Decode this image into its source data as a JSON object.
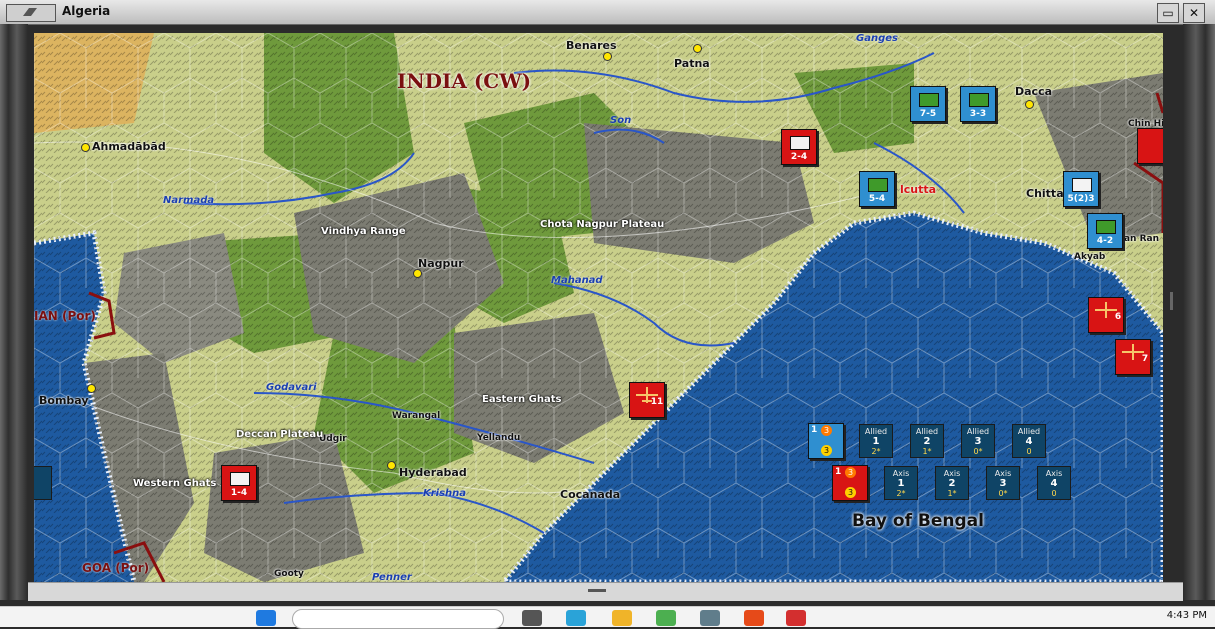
{
  "window": {
    "title": "Algeria",
    "buttons": [
      "▭",
      "✕"
    ]
  },
  "labels": {
    "country_india": "INDIA (CW)",
    "country_portugal_diu": "IAN (Por)",
    "country_goa": "GOA (Por)",
    "sea": "Bay of Bengal",
    "cities": {
      "benares": "Benares",
      "patna": "Patna",
      "dacca": "Dacca",
      "ahmadabad": "Ahmadābād",
      "nagpur": "Nagpur",
      "bombay": "Bombay",
      "hyderabad": "Hyderabad",
      "cocanada": "Cocanada",
      "calcutta": "lcutta",
      "chittagong": "Chittag",
      "akyab": "Akyab",
      "warangal": "Warangal",
      "yellandu": "Yellandu",
      "udgir": "Udgir",
      "gooty": "Gooty",
      "chin": "Chin Hi",
      "arakan": "kan Ran"
    },
    "rivers": {
      "narmada": "Narmada",
      "son": "Son",
      "mahanadi": "Mahanad",
      "godavari": "Godavari",
      "krishna": "Krishna",
      "penner": "Penner",
      "ganges": "Ganges"
    },
    "regions": {
      "vindhya": "Vindhya Range",
      "chota_nagpur": "Chota Nagpur Plateau",
      "eastern_ghats": "Eastern Ghats",
      "deccan": "Deccan Plateau",
      "western_ghats": "Western Ghats"
    }
  },
  "units": {
    "blue_75": "7-5",
    "blue_33": "3-3",
    "blue_54": "5-4",
    "blue_523": "5(2)3",
    "blue_42": "4-2",
    "red_24": "2-4",
    "red_14": "1-4",
    "red_plane": "11",
    "red_right_1": "6",
    "red_right_2": "7"
  },
  "track": {
    "allied": {
      "title": "Allied",
      "slots": [
        {
          "n": "1",
          "v": "2*"
        },
        {
          "n": "2",
          "v": "1*"
        },
        {
          "n": "3",
          "v": "0*"
        },
        {
          "n": "4",
          "v": "0"
        }
      ]
    },
    "axis": {
      "title": "Axis",
      "slots": [
        {
          "n": "1",
          "v": "2*"
        },
        {
          "n": "2",
          "v": "1*"
        },
        {
          "n": "3",
          "v": "0*"
        },
        {
          "n": "4",
          "v": "0"
        }
      ]
    },
    "allied_stack": {
      "num": "1",
      "top": "3",
      "bottom": "3"
    },
    "axis_stack": {
      "num": "1",
      "top": "3",
      "bottom": "3"
    }
  },
  "taskbar": {
    "clock": "4:43 PM"
  },
  "colors": {
    "sea": "#1e5aa0",
    "allied": "#2f8fd0",
    "axis": "#d81414",
    "border": "#8a0f0f"
  }
}
